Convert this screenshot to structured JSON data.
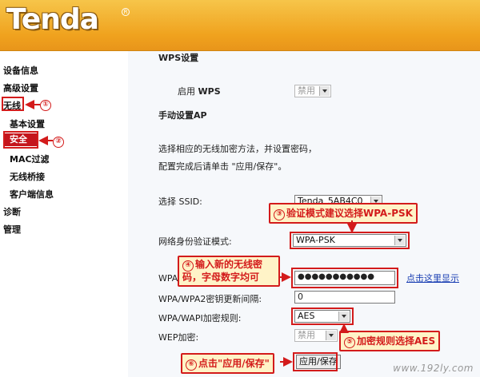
{
  "header": {
    "logo": "Tenda",
    "registered": "R"
  },
  "sidebar": {
    "items": [
      {
        "label": "设备信息"
      },
      {
        "label": "高级设置"
      },
      {
        "label": "无线"
      },
      {
        "label": "基本设置"
      },
      {
        "label": "安全"
      },
      {
        "label": "MAC过滤"
      },
      {
        "label": "无线桥接"
      },
      {
        "label": "客户端信息"
      },
      {
        "label": "诊断"
      },
      {
        "label": "管理"
      }
    ]
  },
  "wps": {
    "section_title": "WPS设置",
    "enable_label_prefix": "启用",
    "enable_label_wps": "WPS",
    "select_value": "禁用"
  },
  "manual": {
    "section_title": "手动设置AP",
    "desc_line1": "选择相应的无线加密方法，并设置密码，",
    "desc_line2": "配置完成后请单击 \"应用/保存\"。"
  },
  "form": {
    "ssid_label": "选择 SSID:",
    "ssid_value": "Tenda_5AB4C0",
    "auth_label": "网络身份验证模式:",
    "auth_value": "WPA-PSK",
    "psk_label": "WPA/",
    "psk_value": "●●●●●●●●●●●",
    "show_link": "点击这里显示",
    "rekey_label": "WPA/WPA2密钥更新间隔:",
    "rekey_value": "0",
    "cipher_label": "WPA/WAPI加密规则:",
    "cipher_value": "AES",
    "wep_label": "WEP加密:",
    "wep_value": "禁用",
    "save_button": "应用/保存"
  },
  "callouts": {
    "c1_num": "①",
    "c2_num": "②",
    "c3_num": "③",
    "c3_text": "验证模式建议选择WPA-PSK",
    "c4_num": "④",
    "c4_line1": "输入新的无线密",
    "c4_line2": "码，字母数字均可",
    "c5_num": "⑤",
    "c5_text": "加密规则选择AES",
    "c6_num": "⑥",
    "c6_text": "点击\"应用/保存\""
  },
  "watermark": "www.192ly.com"
}
